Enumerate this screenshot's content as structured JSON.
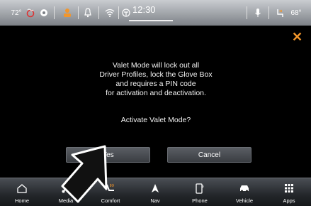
{
  "status": {
    "temperature_left": "72°",
    "time": "12:30",
    "temperature_right": "68°"
  },
  "dialog": {
    "message_lines": [
      "Valet  Mode will lock out all",
      "Driver Profiles, lock the Glove Box",
      "and requires a PIN code",
      "for activation and deactivation."
    ],
    "question": "Activate Valet Mode?",
    "yes_label": "Yes",
    "cancel_label": "Cancel",
    "close_icon": "close-icon"
  },
  "nav": {
    "items": [
      {
        "label": "Home",
        "icon": "home-icon"
      },
      {
        "label": "Media",
        "icon": "music-note-icon"
      },
      {
        "label": "Comfort",
        "icon": "heated-seat-icon"
      },
      {
        "label": "Nav",
        "icon": "navigation-arrow-icon"
      },
      {
        "label": "Phone",
        "icon": "phone-icon"
      },
      {
        "label": "Vehicle",
        "icon": "car-icon"
      },
      {
        "label": "Apps",
        "icon": "apps-grid-icon"
      }
    ]
  },
  "colors": {
    "accent_orange": "#f2962c",
    "background": "#000000"
  }
}
